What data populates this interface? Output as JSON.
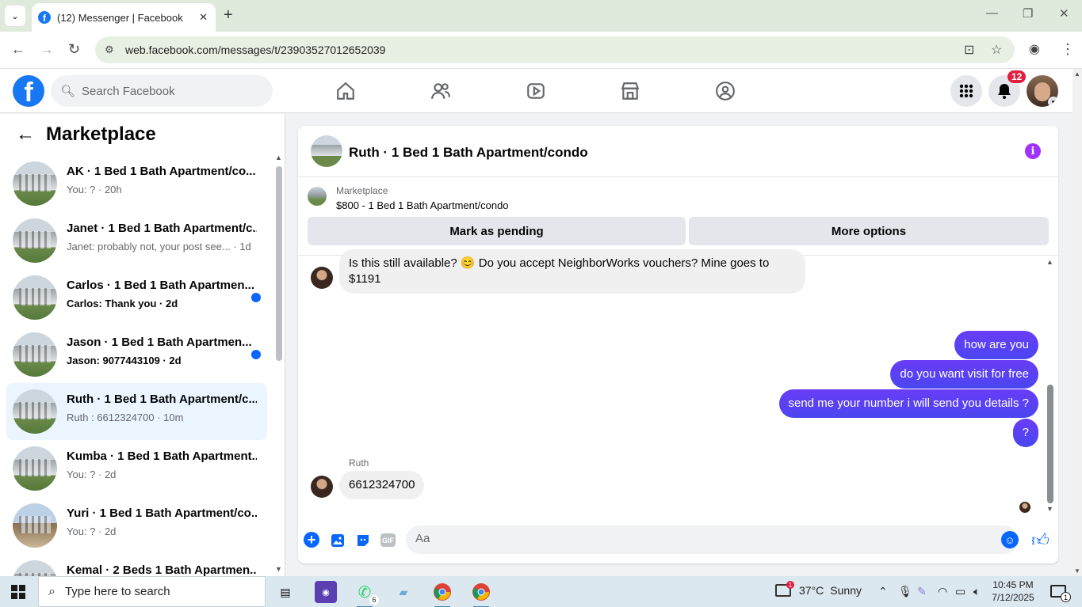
{
  "browser": {
    "tab_title": "(12) Messenger | Facebook",
    "url": "web.facebook.com/messages/t/23903527012652039",
    "window_controls": [
      "minimize",
      "restore",
      "close"
    ]
  },
  "facebook": {
    "logo": "f",
    "search_placeholder": "Search Facebook",
    "nav_icons": [
      "home-icon",
      "friends-icon",
      "video-icon",
      "marketplace-icon",
      "groups-icon"
    ],
    "notification_count": "12"
  },
  "sidebar": {
    "title": "Marketplace",
    "conversations": [
      {
        "name": "AK · 1 Bed 1 Bath Apartment/co...",
        "preview": "You: ? · 20h",
        "unread": false,
        "active": false
      },
      {
        "name": "Janet · 1 Bed 1 Bath Apartment/c...",
        "preview": "Janet: probably not, your post see... · 1d",
        "unread": false,
        "active": false
      },
      {
        "name": "Carlos · 1 Bed 1 Bath Apartmen...",
        "preview": "Carlos: Thank you · 2d",
        "unread": true,
        "active": false
      },
      {
        "name": "Jason · 1 Bed 1 Bath Apartmen...",
        "preview": "Jason: 9077443109 · 2d",
        "unread": true,
        "active": false
      },
      {
        "name": "Ruth · 1 Bed 1 Bath Apartment/c...",
        "preview": "Ruth : 6612324700 · 10m",
        "unread": false,
        "active": true
      },
      {
        "name": "Kumba · 1 Bed 1 Bath Apartment...",
        "preview": "You: ? · 2d",
        "unread": false,
        "active": false
      },
      {
        "name": "Yuri · 1 Bed 1 Bath Apartment/co...",
        "preview": "You: ? · 2d",
        "unread": false,
        "active": false
      },
      {
        "name": "Kemal · 2 Beds 1 Bath Apartmen...",
        "preview": "",
        "unread": false,
        "active": false
      }
    ]
  },
  "chat": {
    "title": "Ruth · 1 Bed 1 Bath Apartment/condo",
    "listing_label": "Marketplace",
    "listing_price": "$800 - 1 Bed 1 Bath Apartment/condo",
    "mark_pending_label": "Mark as pending",
    "more_options_label": "More options",
    "messages": [
      {
        "from": "them",
        "text": "Is this still available? 😊 Do you accept NeighborWorks vouchers? Mine goes to $1191"
      },
      {
        "from": "me",
        "text": "how are you"
      },
      {
        "from": "me",
        "text": "do you want visit for free"
      },
      {
        "from": "me",
        "text": "send me your number i will send you details ?"
      },
      {
        "from": "me",
        "text": "?"
      },
      {
        "from": "them",
        "sender": "Ruth",
        "text": "6612324700"
      }
    ],
    "composer_placeholder": "Aa"
  },
  "taskbar": {
    "search_placeholder": "Type here to search",
    "whatsapp_badge": "6",
    "weather_temp": "37°C",
    "weather_cond": "Sunny",
    "weather_badge": "1",
    "time": "10:45 PM",
    "date": "7/12/2025",
    "action_center_count": "1"
  }
}
